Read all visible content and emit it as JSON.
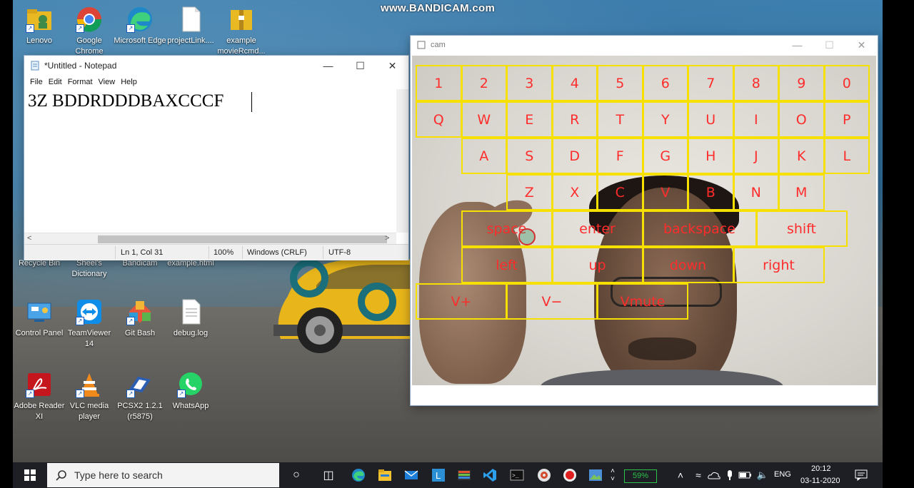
{
  "watermark": "www.BANDICAM.com",
  "desktop_icons": [
    {
      "label": "Lenovo",
      "icon": "folder-user-icon"
    },
    {
      "label": "Google Chrome",
      "icon": "chrome-icon"
    },
    {
      "label": "Microsoft Edge",
      "icon": "edge-icon"
    },
    {
      "label": "projectLink....",
      "icon": "document-icon"
    },
    {
      "label": "example movieRcmd...",
      "icon": "zip-folder-icon"
    },
    {
      "label": "Recycle Bin",
      "icon": "recycle-bin-icon"
    },
    {
      "label": "Sheel's Dictionary",
      "icon": "app-icon"
    },
    {
      "label": "Bandicam",
      "icon": "bandicam-icon"
    },
    {
      "label": "example.html",
      "icon": "html-icon"
    },
    {
      "label": "Control Panel",
      "icon": "control-panel-icon"
    },
    {
      "label": "TeamViewer 14",
      "icon": "teamviewer-icon"
    },
    {
      "label": "Git Bash",
      "icon": "git-bash-icon"
    },
    {
      "label": "debug.log",
      "icon": "text-file-icon"
    },
    {
      "label": "Adobe Reader XI",
      "icon": "adobe-reader-icon"
    },
    {
      "label": "VLC media player",
      "icon": "vlc-icon"
    },
    {
      "label": "PCSX2 1.2.1 (r5875)",
      "icon": "pcsx2-icon"
    },
    {
      "label": "WhatsApp",
      "icon": "whatsapp-icon"
    }
  ],
  "notepad": {
    "title": "*Untitled - Notepad",
    "menu": [
      "File",
      "Edit",
      "Format",
      "View",
      "Help"
    ],
    "content": "3Z BDDRDDDBAXCCCF",
    "status": {
      "position": "Ln 1, Col 31",
      "zoom": "100%",
      "line_ending": "Windows (CRLF)",
      "encoding": "UTF-8"
    }
  },
  "cam": {
    "title": "cam",
    "rows": [
      [
        "1",
        "2",
        "3",
        "4",
        "5",
        "6",
        "7",
        "8",
        "9",
        "0"
      ],
      [
        "Q",
        "W",
        "E",
        "R",
        "T",
        "Y",
        "U",
        "I",
        "O",
        "P"
      ],
      [
        "A",
        "S",
        "D",
        "F",
        "G",
        "H",
        "J",
        "K",
        "L"
      ],
      [
        "Z",
        "X",
        "C",
        "V",
        "B",
        "N",
        "M"
      ]
    ],
    "special_row1": [
      "space",
      "enter",
      "backspace",
      "shift"
    ],
    "special_row2": [
      "left",
      "up",
      "down",
      "right"
    ],
    "special_row3": [
      "V+",
      "V−",
      "Vmute"
    ],
    "key_border_color": "#f5e000",
    "key_text_color": "#ff2c2c"
  },
  "taskbar": {
    "search_placeholder": "Type here to search",
    "battery": "59%",
    "language": "ENG",
    "time": "20:12",
    "date": "03-11-2020"
  }
}
